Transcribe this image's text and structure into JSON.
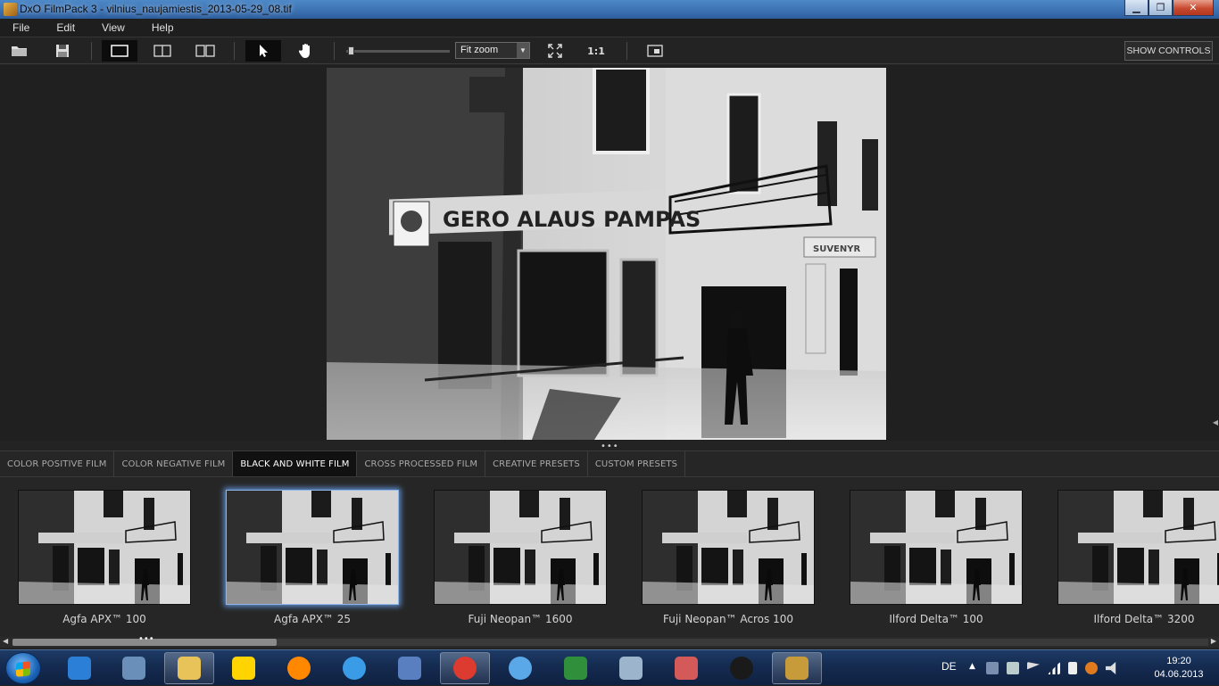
{
  "window": {
    "title": "DxO FilmPack 3 - vilnius_naujamiestis_2013-05-29_08.tif",
    "minimize": "▁",
    "maximize": "❐",
    "close": "✕"
  },
  "menu": [
    "File",
    "Edit",
    "View",
    "Help"
  ],
  "toolbar": {
    "zoom_value": "Fit zoom",
    "one_to_one": "1:1",
    "show_controls": "SHOW CONTROLS"
  },
  "tabs": [
    {
      "label": "COLOR POSITIVE FILM",
      "active": false
    },
    {
      "label": "COLOR NEGATIVE FILM",
      "active": false
    },
    {
      "label": "BLACK AND WHITE FILM",
      "active": true
    },
    {
      "label": "CROSS PROCESSED FILM",
      "active": false
    },
    {
      "label": "CREATIVE PRESETS",
      "active": false
    },
    {
      "label": "CUSTOM PRESETS",
      "active": false
    }
  ],
  "films": [
    {
      "label": "Agfa APX™ 100",
      "selected": false,
      "tone": "#8a8a8a"
    },
    {
      "label": "Agfa APX™ 25",
      "selected": true,
      "tone": "#5a5a5a"
    },
    {
      "label": "Fuji Neopan™ 1600",
      "selected": false,
      "tone": "#6e6e6e"
    },
    {
      "label": "Fuji Neopan™ Acros 100",
      "selected": false,
      "tone": "#7a7a7a"
    },
    {
      "label": "Ilford Delta™ 100",
      "selected": false,
      "tone": "#7e7e7e"
    },
    {
      "label": "Ilford Delta™ 3200",
      "selected": false,
      "tone": "#747474"
    }
  ],
  "photo_signs": {
    "main_sign": "GERO ALAUS PAMPAS",
    "small_sign": "SUVENYR"
  },
  "taskbar": {
    "language": "DE",
    "time": "19:20",
    "date": "04.06.2013",
    "apps": [
      {
        "name": "teamviewer",
        "color": "#2b7fd6"
      },
      {
        "name": "virtualbox",
        "color": "#6a8fb8"
      },
      {
        "name": "explorer",
        "color": "#e7c35a"
      },
      {
        "name": "lidl-mobile",
        "color": "#ffd400"
      },
      {
        "name": "vlc",
        "color": "#ff8800"
      },
      {
        "name": "itunes",
        "color": "#3a9be6"
      },
      {
        "name": "thunderbird",
        "color": "#5a7fc0"
      },
      {
        "name": "chrome",
        "color": "#de3b30"
      },
      {
        "name": "safari",
        "color": "#5aa8e8"
      },
      {
        "name": "solitaire",
        "color": "#2f8f3a"
      },
      {
        "name": "calculator",
        "color": "#9cb4cc"
      },
      {
        "name": "snipping",
        "color": "#d45a5a"
      },
      {
        "name": "camera-app",
        "color": "#1a1a1a"
      },
      {
        "name": "filmpack",
        "color": "#c79a3a"
      }
    ]
  }
}
